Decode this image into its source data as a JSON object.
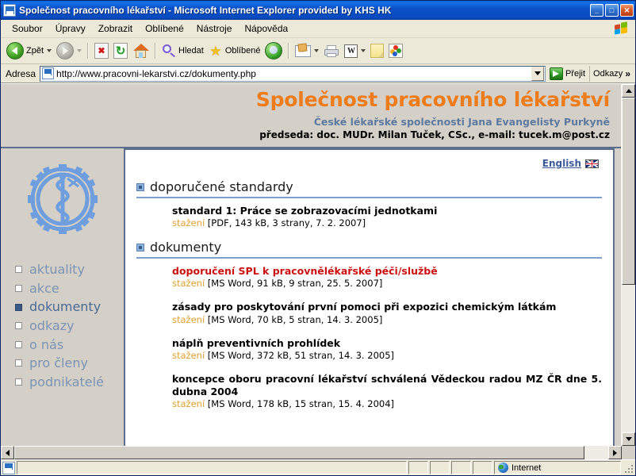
{
  "window": {
    "title": "Společnost pracovního lékařství - Microsoft Internet Explorer provided by KHS HK",
    "minimize": "_",
    "maximize": "□",
    "close": "✕"
  },
  "menu": {
    "items": [
      {
        "label": "Soubor"
      },
      {
        "label": "Úpravy"
      },
      {
        "label": "Zobrazit"
      },
      {
        "label": "Oblíbené"
      },
      {
        "label": "Nástroje"
      },
      {
        "label": "Nápověda"
      }
    ]
  },
  "toolbar": {
    "back_label": "Zpět",
    "forward_label": "",
    "search_label": "Hledat",
    "favorites_label": "Oblíbené",
    "icons": [
      "back-icon",
      "forward-icon",
      "stop-icon",
      "refresh-icon",
      "home-icon",
      "search-icon",
      "favorites-star-icon",
      "media-icon",
      "mail-icon",
      "print-icon",
      "word-icon",
      "note-icon",
      "messenger-icon"
    ]
  },
  "address": {
    "label": "Adresa",
    "url": "http://www.pracovni-lekarstvi.cz/dokumenty.php",
    "go_label": "Přejit",
    "links_label": "Odkazy",
    "links_chevron": "»"
  },
  "site": {
    "title": "Společnost pracovního lékařství",
    "subtitle": "České lékařské společnosti Jana Evangelisty Purkyně",
    "chairman": "předseda: doc. MUDr. Milan Tuček, CSc., e-mail: tucek.m@post.cz",
    "language_link": "English"
  },
  "sidebar": {
    "logo_name": "asclepius-gear-logo",
    "items": [
      {
        "label": "aktuality",
        "active": false
      },
      {
        "label": "akce",
        "active": false
      },
      {
        "label": "dokumenty",
        "active": true
      },
      {
        "label": "odkazy",
        "active": false
      },
      {
        "label": "o nás",
        "active": false
      },
      {
        "label": "pro členy",
        "active": false
      },
      {
        "label": "podnikatelé",
        "active": false
      }
    ]
  },
  "content": {
    "sections": [
      {
        "heading": "doporučené standardy",
        "documents": [
          {
            "title": "standard 1: Práce se zobrazovacími jednotkami",
            "download": "stažení",
            "meta": " [PDF, 143 kB, 3 strany, 7. 2. 2007]",
            "highlight": false
          }
        ]
      },
      {
        "heading": "dokumenty",
        "documents": [
          {
            "title": "doporučení SPL k pracovnělékařské péči/službě",
            "download": "stažení",
            "meta": " [MS Word, 91 kB, 9 stran, 25. 5. 2007]",
            "highlight": true
          },
          {
            "title": "zásady pro poskytování první pomoci při expozici chemickým látkám",
            "download": "stažení",
            "meta": " [MS Word, 70 kB, 5 stran, 14. 3. 2005]",
            "highlight": false
          },
          {
            "title": "náplň preventivních prohlídek",
            "download": "stažení",
            "meta": " [MS Word, 372 kB, 51 stran, 14. 3. 2005]",
            "highlight": false
          },
          {
            "title": "koncepce oboru pracovní lékařství schválená Vědeckou radou MZ ČR dne 5. dubna 2004",
            "download": "stažení",
            "meta": " [MS Word, 178 kB, 15 stran, 15. 4. 2004]",
            "highlight": false
          }
        ]
      }
    ]
  },
  "statusbar": {
    "message": "",
    "zone": "Internet"
  },
  "colors": {
    "brand_orange": "#ef7c1a",
    "subtitle_blue": "#5d7aa0",
    "border_slate": "#5b6f8d",
    "nav_blue": "#7b93b4",
    "highlight_red": "#cc1111",
    "download_orange": "#e0a030",
    "rule_blue": "#7ba0cf"
  }
}
